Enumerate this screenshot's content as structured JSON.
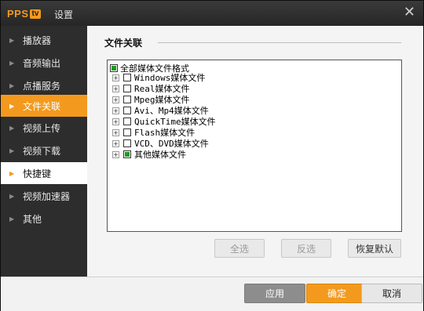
{
  "window": {
    "logo_text": "PPS",
    "logo_badge": "tv",
    "title": "设置",
    "close_glyph": "✕"
  },
  "sidebar": {
    "items": [
      {
        "label": "播放器"
      },
      {
        "label": "音频输出"
      },
      {
        "label": "点播服务"
      },
      {
        "label": "文件关联"
      },
      {
        "label": "视频上传"
      },
      {
        "label": "视频下载"
      },
      {
        "label": "快捷键"
      },
      {
        "label": "视频加速器"
      },
      {
        "label": "其他"
      }
    ],
    "active_label": "文件关联",
    "hover_label": "快捷键"
  },
  "section": {
    "title": "文件关联"
  },
  "tree": {
    "root_label": "全部媒体文件格式",
    "root_checked": true,
    "items": [
      {
        "label": "Windows媒体文件",
        "checked": false
      },
      {
        "label": "Real媒体文件",
        "checked": false
      },
      {
        "label": "Mpeg媒体文件",
        "checked": false
      },
      {
        "label": "Avi、Mp4媒体文件",
        "checked": false
      },
      {
        "label": "QuickTime媒体文件",
        "checked": false
      },
      {
        "label": "Flash媒体文件",
        "checked": false
      },
      {
        "label": "VCD、DVD媒体文件",
        "checked": false
      },
      {
        "label": "其他媒体文件",
        "checked": true
      }
    ],
    "expander_glyph": "+"
  },
  "actions": {
    "select_all": "全选",
    "invert": "反选",
    "restore_default": "恢复默认"
  },
  "footer": {
    "apply": "应用",
    "ok": "确定",
    "cancel": "取消"
  },
  "colors": {
    "accent": "#f39a1e",
    "check_green": "#1e9a1e"
  }
}
